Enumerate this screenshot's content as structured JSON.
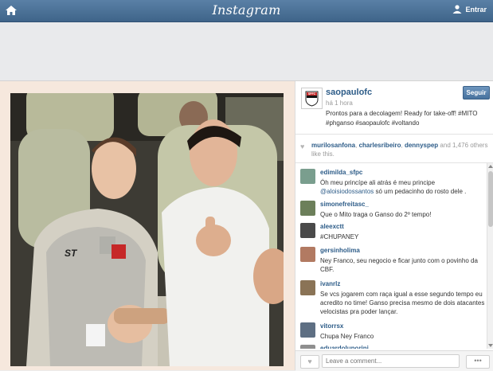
{
  "header": {
    "brand": "Instagram",
    "login_label": "Entrar",
    "icons": {
      "home": "home-icon",
      "user": "user-icon"
    }
  },
  "post": {
    "username": "saopaulofc",
    "time": "há 1 hora",
    "follow_label": "Seguir",
    "caption": "Prontos para a decolagem! Ready for take-off! #MITO #phganso #saopaulofc #voltando",
    "likes": {
      "names": [
        "murilosanfona",
        "charlesribeiro",
        "dennyspep"
      ],
      "count_text": "and 1,476 others like this."
    },
    "comments": [
      {
        "user": "edimilda_sfpc",
        "text": "Óh meu princípe ali atrás é meu principe",
        "mention": "@aloisiodossantos",
        "text2": " só um pedacinho do rosto dele .",
        "avatar_color": "#7a9e8e"
      },
      {
        "user": "simonefreitasc_",
        "text": "Que o Mito traga o Ganso do 2º tempo!",
        "avatar_color": "#6c7f5a"
      },
      {
        "user": "aleexctt",
        "text": "#CHUPANEY",
        "avatar_color": "#4a4a4a"
      },
      {
        "user": "gersinholima",
        "text": "Ney Franco, seu negocio e ficar junto com o povinho da CBF.",
        "avatar_color": "#b27a62"
      },
      {
        "user": "ivanrlz",
        "text": "Se vcs jogarem com raça igual a esse segundo tempo eu acredito no time! Ganso precisa mesmo de dois atacantes velocistas pra poder lançar.",
        "avatar_color": "#8a7356"
      },
      {
        "user": "vitorrsx",
        "text": "Chupa Ney Franco",
        "avatar_color": "#5e6f83"
      },
      {
        "user": "eduardoluporini",
        "text": "",
        "avatar_color": "#8f8f8f"
      }
    ],
    "comment_placeholder": "Leave a comment...",
    "more_label": "•••"
  },
  "colors": {
    "link": "#2d5c88",
    "topbar": "#4a6f95",
    "follow": "#5a83ad"
  }
}
